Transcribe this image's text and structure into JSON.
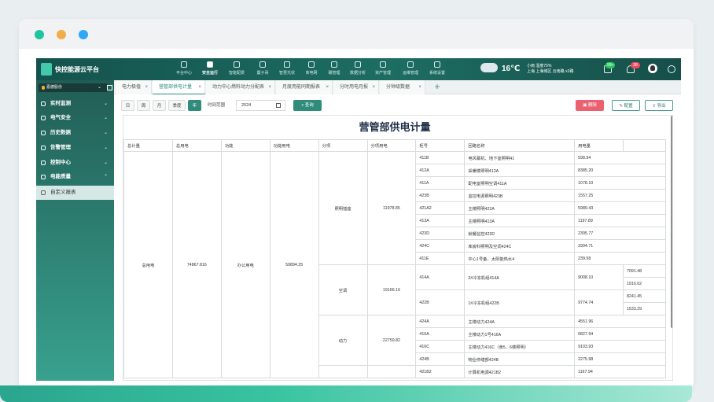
{
  "app": {
    "name": "快控能源云平台"
  },
  "top_nav": [
    {
      "label": "平台中心",
      "icon": "apps-icon"
    },
    {
      "label": "安全运行",
      "icon": "shield-icon"
    },
    {
      "label": "智能配费",
      "icon": "recycle-icon"
    },
    {
      "label": "震子哥",
      "icon": "grid-icon"
    },
    {
      "label": "智慧光伏",
      "icon": "solar-icon"
    },
    {
      "label": "商电网",
      "icon": "network-icon"
    },
    {
      "label": "碳管理",
      "icon": "leaf-icon"
    },
    {
      "label": "数据分析",
      "icon": "chart-icon"
    },
    {
      "label": "资产管理",
      "icon": "database-icon"
    },
    {
      "label": "运维管理",
      "icon": "tools-icon"
    },
    {
      "label": "系统设置",
      "icon": "gear-icon"
    }
  ],
  "active_nav": "安全运行",
  "weather": {
    "temp": "16℃",
    "desc": "小雨 湿度75%",
    "detail": "上海 上海城区 云南路 x3路"
  },
  "badges": {
    "messages": "99+",
    "alerts": "38"
  },
  "company": "嘉德股份",
  "sidebar": [
    {
      "label": "实时监测"
    },
    {
      "label": "电气安全"
    },
    {
      "label": "历史数据"
    },
    {
      "label": "告警管理"
    },
    {
      "label": "控制中心"
    },
    {
      "label": "电能质量"
    },
    {
      "label": "自定义报表"
    }
  ],
  "tabs": [
    {
      "label": "电力极值"
    },
    {
      "label": "营管部供电计量"
    },
    {
      "label": "动力中心燃料动力分配表"
    },
    {
      "label": "月度用能同期报表"
    },
    {
      "label": "分时用电月报"
    },
    {
      "label": "分钟级数据"
    }
  ],
  "toolbar": {
    "periods": [
      "日",
      "周",
      "月",
      "季度",
      "年"
    ],
    "active_period": "年",
    "time_label": "时间范围",
    "year": "2024",
    "query": "查询",
    "delete": "删除",
    "config": "配置",
    "export": "导出"
  },
  "report": {
    "title": "营管部供电计量",
    "headers": [
      "总计量",
      "总用电",
      "功能",
      "功能用电",
      "分项",
      "分项用电",
      "柜号",
      "回路名称",
      "用电量",
      ""
    ],
    "total_label": "总用电",
    "total_value": "74867.816",
    "function_label": "办公用电",
    "function_value": "59894.25",
    "groups": [
      {
        "name": "照明插座",
        "value": "11978.85"
      },
      {
        "name": "空调",
        "value": "19166.16"
      },
      {
        "name": "动力",
        "value": "22759.82"
      }
    ],
    "rows": [
      [
        "411B",
        "电风幕机、地下室照明41",
        "598.94"
      ],
      [
        "412A",
        "采暖楼照明412A",
        "8385.20"
      ],
      [
        "411A",
        "配电室照明空调411A",
        "1078.10"
      ],
      [
        "423B",
        "监控电源照明423B",
        "1557.25"
      ],
      [
        "421A2",
        "主楼照明422A",
        "5989.43"
      ],
      [
        "413A",
        "主楼照明413A",
        "1197.89"
      ],
      [
        "423D",
        "就餐监控423D",
        "2395.77"
      ],
      [
        "424C",
        "库房科照明及空调424C",
        "2994.71"
      ],
      [
        "411E",
        "中心1号备、太阳能热水4",
        "239.58"
      ]
    ],
    "ac_rows": [
      [
        "414A",
        "2#冷冻机组414A",
        "9008.10",
        "7091.48",
        "1916.62"
      ],
      [
        "422B",
        "1#冷冻机组422B",
        "9774.74",
        "8241.45",
        "1533.29"
      ]
    ],
    "power_rows": [
      [
        "424A",
        "主楼动力424A",
        "4551.96"
      ],
      [
        "416A",
        "主楼动力1号416A",
        "6827.94"
      ],
      [
        "416C",
        "主楼动力416C（食5、6楼照明）",
        "9103.93"
      ],
      [
        "424B",
        "物业修缮部424B",
        "2275.98"
      ],
      [
        "421B2",
        "计算机电源421B2",
        "1167.94"
      ]
    ]
  },
  "colors": {
    "brand": "#1d6d62",
    "accent": "#2f8c7b",
    "danger": "#e85c6a"
  }
}
